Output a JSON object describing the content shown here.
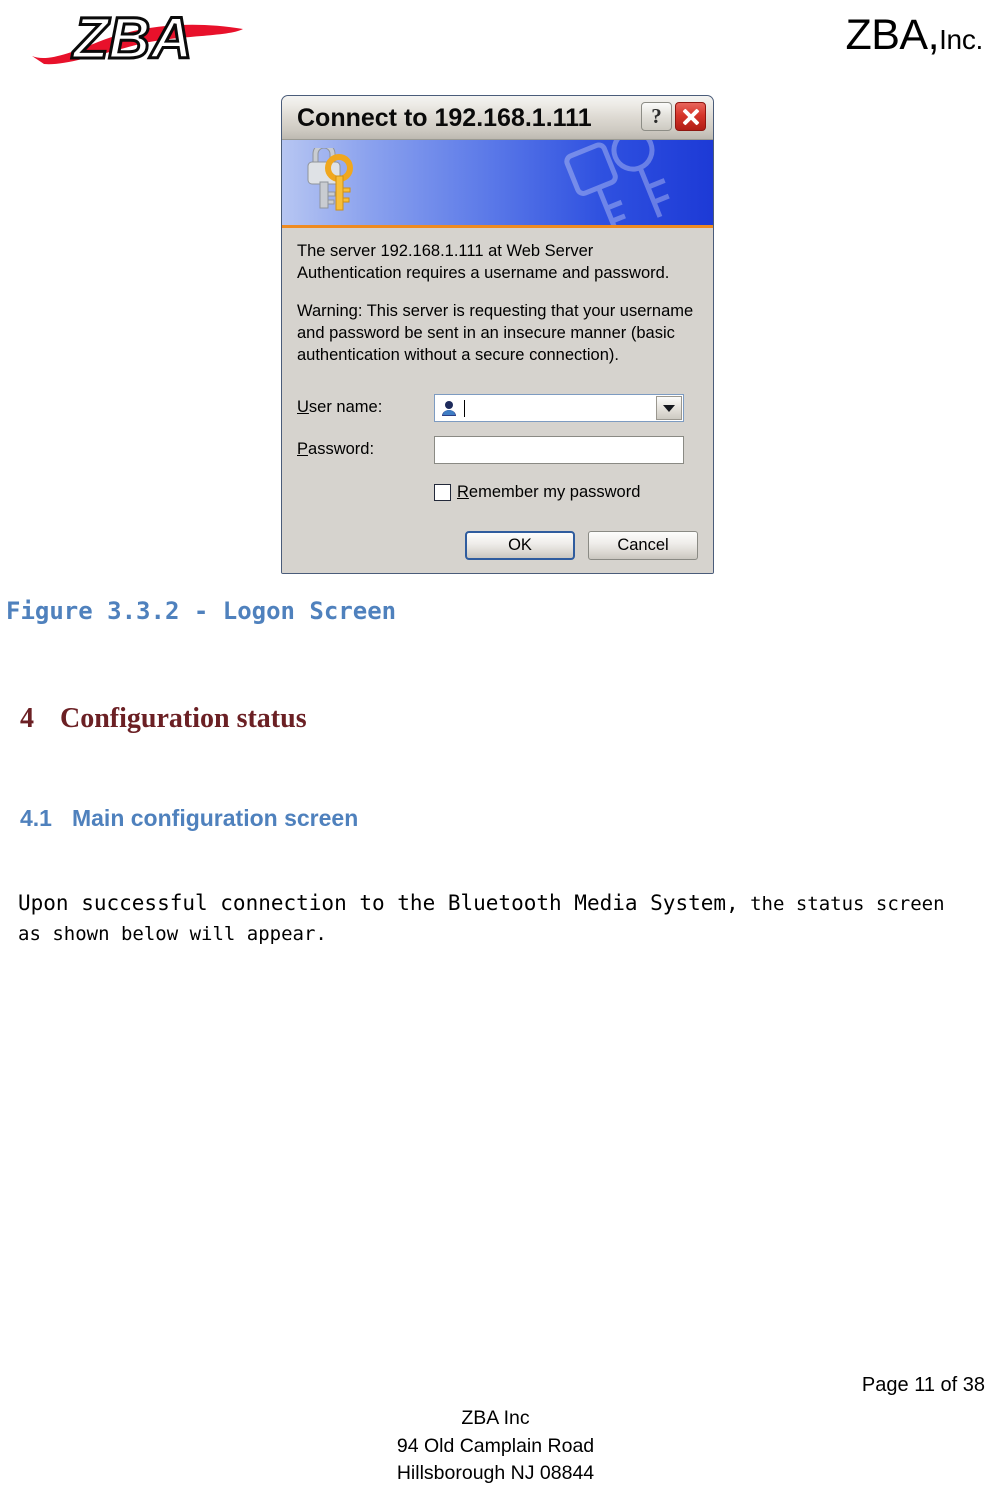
{
  "header": {
    "logo_alt": "ZBA",
    "company_primary": "ZBA,",
    "company_secondary": "Inc."
  },
  "dialog": {
    "title": "Connect to 192.168.1.111",
    "help_button": "?",
    "banner_icon": "keys-icon",
    "server_message": "The server 192.168.1.111 at Web Server Authentication requires a username and password.",
    "warning_message": "Warning: This server is requesting that your username and password be sent in an insecure manner (basic authentication without a secure connection).",
    "username_label": "User name:",
    "username_value": "",
    "username_placeholder": "",
    "password_label": "Password:",
    "password_value": "",
    "password_placeholder": "",
    "remember_label": "Remember my password",
    "remember_checked": false,
    "ok_label": "OK",
    "cancel_label": "Cancel"
  },
  "document": {
    "figure_caption": "Figure 3.3.2 - Logon Screen",
    "heading_4_number": "4",
    "heading_4_text": "Configuration status",
    "heading_41_number": "4.1",
    "heading_41_text": "Main configuration screen",
    "paragraph_lead": "Upon successful connection to the Bluetooth Media System,",
    "paragraph_tail": " the status screen as shown below will appear."
  },
  "footer": {
    "page_number": "Page 11 of 38",
    "company": "ZBA Inc",
    "street": "94 Old Camplain Road",
    "city_state_zip": "Hillsborough NJ 08844"
  },
  "colors": {
    "figure_caption": "#4F81BD",
    "heading_4": "#6B2024",
    "heading_41": "#4F81BD",
    "logo_accent": "#E8112B",
    "dialog_banner_start": "#B7C6F2",
    "dialog_banner_end": "#1D3AD6",
    "dialog_banner_rule": "#EF8B21",
    "dialog_face": "#D6D3CE",
    "close_button": "#D6352A"
  }
}
